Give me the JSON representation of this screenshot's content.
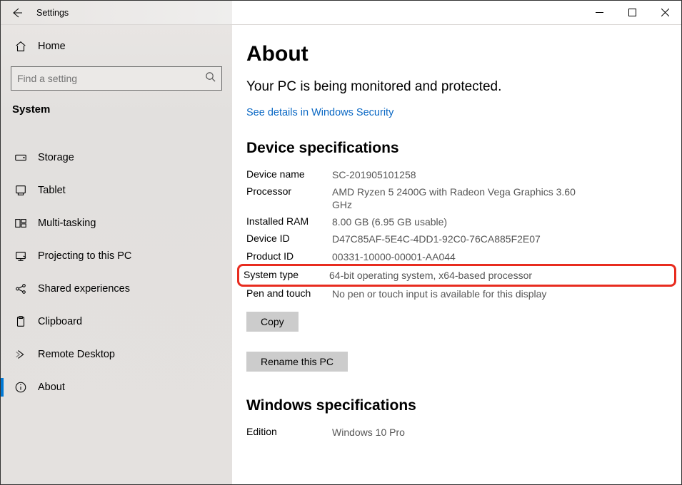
{
  "titlebar": {
    "app_name": "Settings"
  },
  "sidebar": {
    "home_label": "Home",
    "search_placeholder": "Find a setting",
    "group_header": "System",
    "items": [
      {
        "key": "storage",
        "label": "Storage"
      },
      {
        "key": "tablet",
        "label": "Tablet"
      },
      {
        "key": "multitasking",
        "label": "Multi-tasking"
      },
      {
        "key": "projecting",
        "label": "Projecting to this PC"
      },
      {
        "key": "shared",
        "label": "Shared experiences"
      },
      {
        "key": "clipboard",
        "label": "Clipboard"
      },
      {
        "key": "remote",
        "label": "Remote Desktop"
      },
      {
        "key": "about",
        "label": "About"
      }
    ]
  },
  "content": {
    "title": "About",
    "monitoring_text": "Your PC is being monitored and protected.",
    "details_link": "See details in Windows Security",
    "device_spec_heading": "Device specifications",
    "device_specs": {
      "device_name_label": "Device name",
      "device_name_value": "SC-201905101258",
      "processor_label": "Processor",
      "processor_value": "AMD Ryzen 5 2400G with Radeon Vega Graphics 3.60 GHz",
      "ram_label": "Installed RAM",
      "ram_value": "8.00 GB (6.95 GB usable)",
      "device_id_label": "Device ID",
      "device_id_value": "D47C85AF-5E4C-4DD1-92C0-76CA885F2E07",
      "product_id_label": "Product ID",
      "product_id_value": "00331-10000-00001-AA044",
      "system_type_label": "System type",
      "system_type_value": "64-bit operating system, x64-based processor",
      "pen_label": "Pen and touch",
      "pen_value": "No pen or touch input is available for this display"
    },
    "copy_button": "Copy",
    "rename_button": "Rename this PC",
    "win_spec_heading": "Windows specifications",
    "win_specs": {
      "edition_label": "Edition",
      "edition_value": "Windows 10 Pro"
    }
  }
}
